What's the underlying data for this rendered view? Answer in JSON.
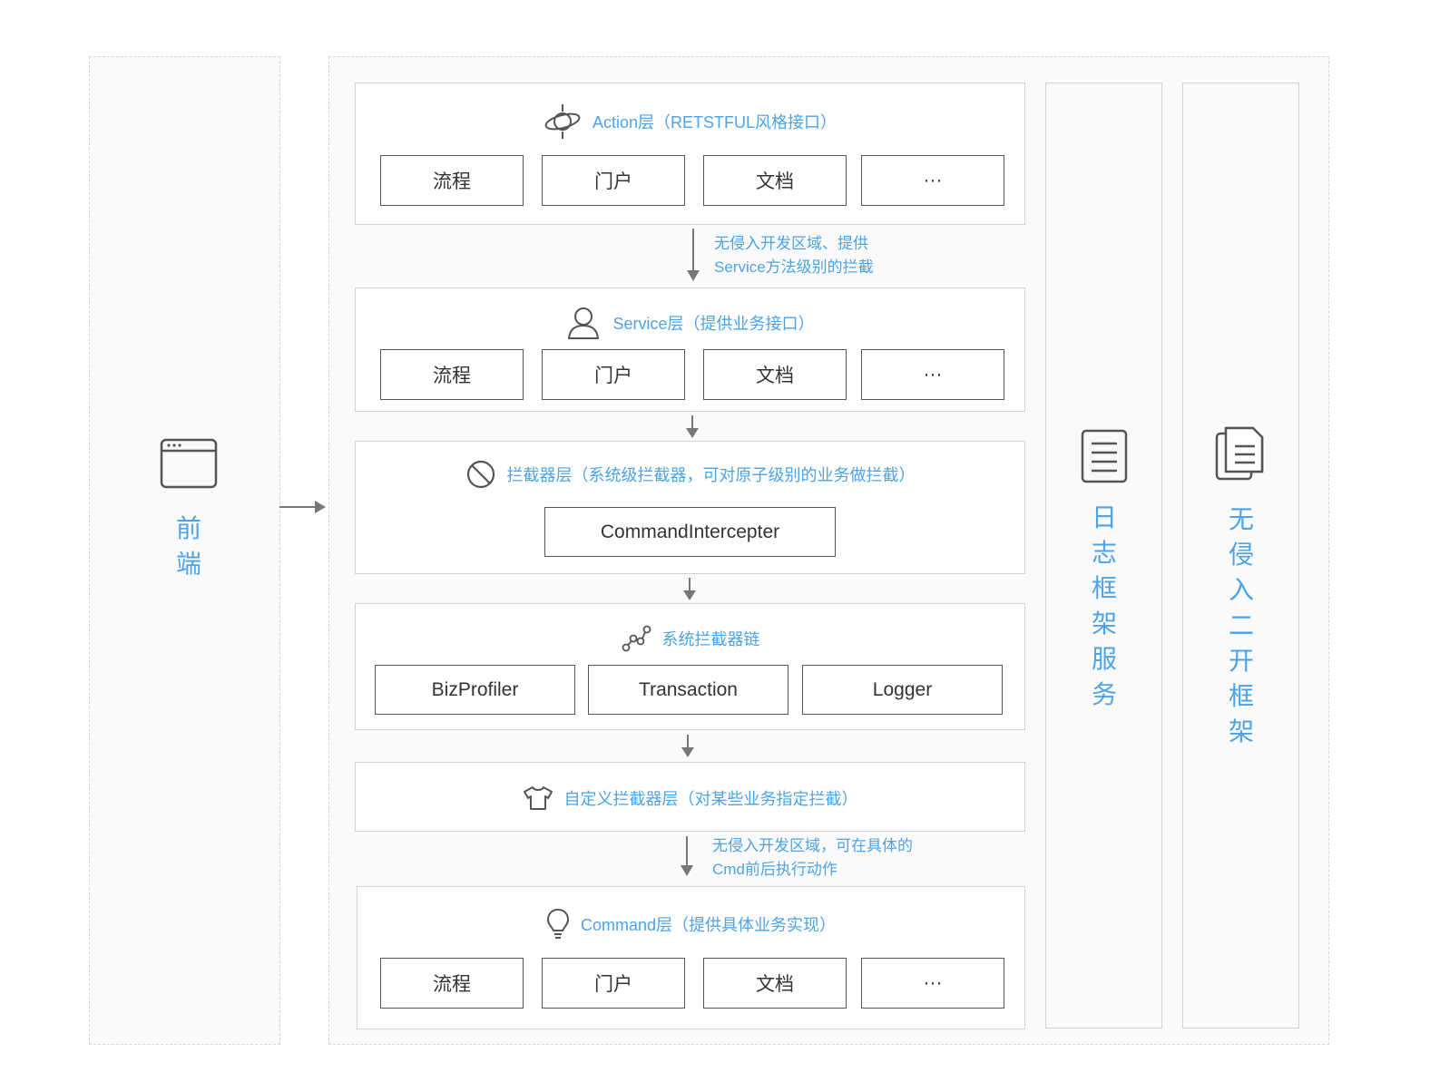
{
  "frontend": {
    "label": "前\n端",
    "icon": "browser-window-icon"
  },
  "layers": {
    "action": {
      "title": "Action层（RETSTFUL风格接口）",
      "icon": "orbit-icon",
      "items": [
        "流程",
        "门户",
        "文档",
        "···"
      ]
    },
    "action_to_service_note": [
      "无侵入开发区域、提供",
      "Service方法级别的拦截"
    ],
    "service": {
      "title": "Service层（提供业务接口）",
      "icon": "user-icon",
      "items": [
        "流程",
        "门户",
        "文档",
        "···"
      ]
    },
    "interceptor": {
      "title": "拦截器层（系统级拦截器，可对原子级别的业务做拦截）",
      "icon": "forbidden-icon",
      "items": [
        "CommandIntercepter"
      ]
    },
    "chain": {
      "title": "系统拦截器链",
      "icon": "chain-nodes-icon",
      "items": [
        "BizProfiler",
        "Transaction",
        "Logger"
      ]
    },
    "custom": {
      "title": "自定义拦截器层（对某些业务指定拦截）",
      "icon": "tshirt-icon"
    },
    "custom_to_command_note": [
      "无侵入开发区域，可在具体的",
      "Cmd前后执行动作"
    ],
    "command": {
      "title": "Command层（提供具体业务实现）",
      "icon": "lightbulb-icon",
      "items": [
        "流程",
        "门户",
        "文档",
        "···"
      ]
    }
  },
  "log_service": {
    "label": "日\n志\n框\n架\n服\n务",
    "icon": "document-icon"
  },
  "framework": {
    "label": "无\n侵\n入\n二\n开\n框\n架",
    "icon": "copy-document-icon"
  },
  "colors": {
    "accent": "#4da3e6",
    "border": "#d2d2d2",
    "box_border": "#555555"
  }
}
